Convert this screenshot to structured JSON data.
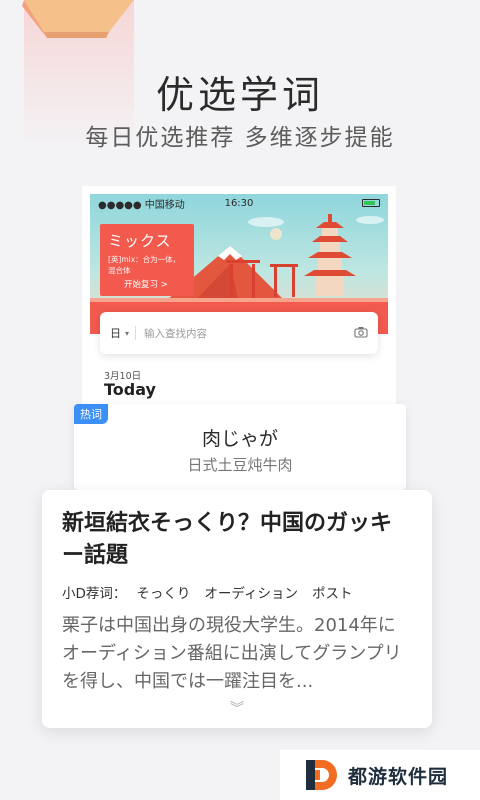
{
  "colors": {
    "accent_red": "#f25a4e",
    "badge_blue": "#3b8ff5",
    "battery_green": "#35c35a",
    "background": "#f3f3f5"
  },
  "promo": {
    "headline": "优选学词",
    "subline": "每日优选推荐  多维逐步提能"
  },
  "phone": {
    "status": {
      "carrier": "●●●●● 中国移动",
      "time": "16:30",
      "battery_icon": "battery-icon"
    },
    "word_card": {
      "word": "ミックス",
      "meaning": "[英]mix：合为一体，混合体",
      "review_label": "开始复习 >"
    },
    "search": {
      "lang": "日",
      "lang_icon": "chevron-down-icon",
      "placeholder": "输入查找内容",
      "camera_icon": "camera-icon"
    },
    "date": "3月10日",
    "today": "Today"
  },
  "hot": {
    "badge": "热词",
    "word": "肉じゃが",
    "meaning": "日式土豆炖牛肉"
  },
  "article": {
    "title": "新垣結衣そっくり？中国のガッキー話題",
    "tags_label": "小D荐词：",
    "tags": [
      "そっくり",
      "オーディション",
      "ポスト"
    ],
    "body": "栗子は中国出身の現役大学生。2014年にオーディション番組に出演してグランプリを得し、中国では一躍注目を...",
    "more_icon": "double-chevron-down-icon",
    "more_glyph": "︾"
  },
  "brand": {
    "name": "都游软件园"
  }
}
